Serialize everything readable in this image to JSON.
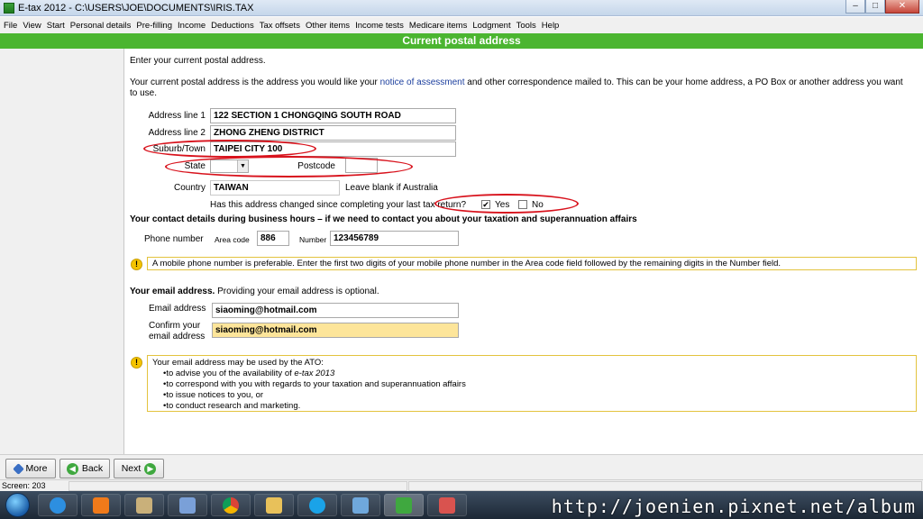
{
  "window": {
    "title": "E-tax 2012 - C:\\USERS\\JOE\\DOCUMENTS\\IRIS.TAX"
  },
  "menu": [
    "File",
    "View",
    "Start",
    "Personal details",
    "Pre-filling",
    "Income",
    "Deductions",
    "Tax offsets",
    "Other items",
    "Income tests",
    "Medicare items",
    "Lodgment",
    "Tools",
    "Help"
  ],
  "header": {
    "title": "Current postal address"
  },
  "intro": {
    "line1": "Enter your current postal address.",
    "line2_pre": "Your current postal address is the address you would like your ",
    "line2_link": "notice of assessment",
    "line2_post": " and other correspondence mailed to. This can be your home address, a PO Box or another address you want to use."
  },
  "address": {
    "line1_label": "Address line 1",
    "line1_value": "122 SECTION 1 CHONGQING SOUTH ROAD",
    "line2_label": "Address line 2",
    "line2_value": "ZHONG ZHENG DISTRICT",
    "suburb_label": "Suburb/Town",
    "suburb_value": "TAIPEI CITY 100",
    "state_label": "State",
    "state_value": "",
    "postcode_label": "Postcode",
    "postcode_value": "",
    "country_label": "Country",
    "country_value": "TAIWAN",
    "country_hint": "Leave blank if Australia",
    "changed_question": "Has this address changed since completing your last tax return?",
    "yes_label": "Yes",
    "yes_checked": true,
    "no_label": "No",
    "no_checked": false
  },
  "contact": {
    "heading": "Your contact details during business hours – if we need to contact you about your taxation and superannuation affairs",
    "phone_label": "Phone number",
    "area_label": "Area code",
    "area_value": "886",
    "number_label": "Number",
    "number_value": "123456789",
    "mobile_note": "A mobile phone number is preferable. Enter the first two digits of your mobile phone number in the Area code field followed by the remaining digits in the Number field."
  },
  "email": {
    "heading_bold": "Your email address.",
    "heading_rest": " Providing your email address is optional.",
    "email_label": "Email address",
    "email_value": "siaoming@hotmail.com",
    "confirm_label_1": "Confirm your",
    "confirm_label_2": "email address",
    "confirm_value": "siaoming@hotmail.com",
    "note_title": "Your email address may be used by the ATO:",
    "note_items": [
      {
        "pre": "•to advise you of the availability of ",
        "em": "e-tax 2013",
        "post": ""
      },
      {
        "pre": "•to correspond with you with regards to your taxation and superannuation affairs",
        "em": "",
        "post": ""
      },
      {
        "pre": "•to issue notices to you, or",
        "em": "",
        "post": ""
      },
      {
        "pre": "•to conduct research and marketing.",
        "em": "",
        "post": ""
      }
    ]
  },
  "buttons": {
    "more": "More",
    "back": "Back",
    "next": "Next"
  },
  "status": {
    "text": "Screen: 203"
  },
  "watermark": "http://joenien.pixnet.net/album",
  "colors": {
    "header_green": "#4bb530",
    "annotation_red": "#d8121c",
    "highlight_yellow": "#fde59a"
  }
}
